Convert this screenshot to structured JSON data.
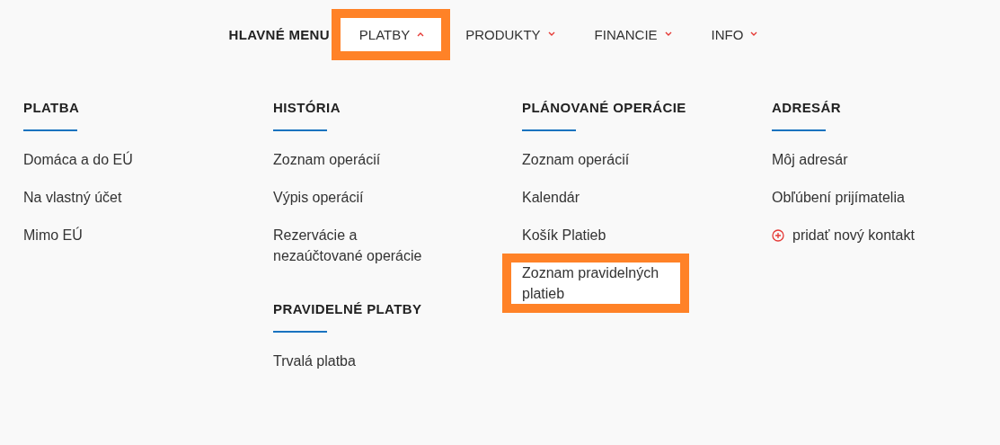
{
  "nav": {
    "title": "HLAVNÉ MENU",
    "items": [
      {
        "label": "PLATBY",
        "expanded": true,
        "highlighted": true
      },
      {
        "label": "PRODUKTY",
        "expanded": false,
        "highlighted": false
      },
      {
        "label": "FINANCIE",
        "expanded": false,
        "highlighted": false
      },
      {
        "label": "INFO",
        "expanded": false,
        "highlighted": false
      }
    ]
  },
  "columns": [
    {
      "sections": [
        {
          "heading": "PLATBA",
          "items": [
            {
              "label": "Domáca a do EÚ",
              "kind": "link",
              "highlighted": false
            },
            {
              "label": "Na vlastný účet",
              "kind": "link",
              "highlighted": false
            },
            {
              "label": "Mimo EÚ",
              "kind": "link",
              "highlighted": false
            }
          ]
        }
      ]
    },
    {
      "sections": [
        {
          "heading": "HISTÓRIA",
          "items": [
            {
              "label": "Zoznam operácií",
              "kind": "link",
              "highlighted": false
            },
            {
              "label": "Výpis operácií",
              "kind": "link",
              "highlighted": false
            },
            {
              "label": "Rezervácie a nezaúčtované operácie",
              "kind": "link",
              "highlighted": false
            }
          ]
        },
        {
          "heading": "PRAVIDELNÉ PLATBY",
          "items": [
            {
              "label": "Trvalá platba",
              "kind": "link",
              "highlighted": false
            }
          ]
        }
      ]
    },
    {
      "sections": [
        {
          "heading": "PLÁNOVANÉ OPERÁCIE",
          "items": [
            {
              "label": "Zoznam operácií",
              "kind": "link",
              "highlighted": false
            },
            {
              "label": "Kalendár",
              "kind": "link",
              "highlighted": false
            },
            {
              "label": "Košík Platieb",
              "kind": "link",
              "highlighted": false
            },
            {
              "label": "Zoznam pravidelných platieb",
              "kind": "link",
              "highlighted": true
            }
          ]
        }
      ]
    },
    {
      "sections": [
        {
          "heading": "ADRESÁR",
          "items": [
            {
              "label": "Môj adresár",
              "kind": "link",
              "highlighted": false
            },
            {
              "label": "Obľúbení prijímatelia",
              "kind": "link",
              "highlighted": false
            },
            {
              "label": "pridať nový kontakt",
              "kind": "add"
            }
          ]
        }
      ]
    }
  ]
}
